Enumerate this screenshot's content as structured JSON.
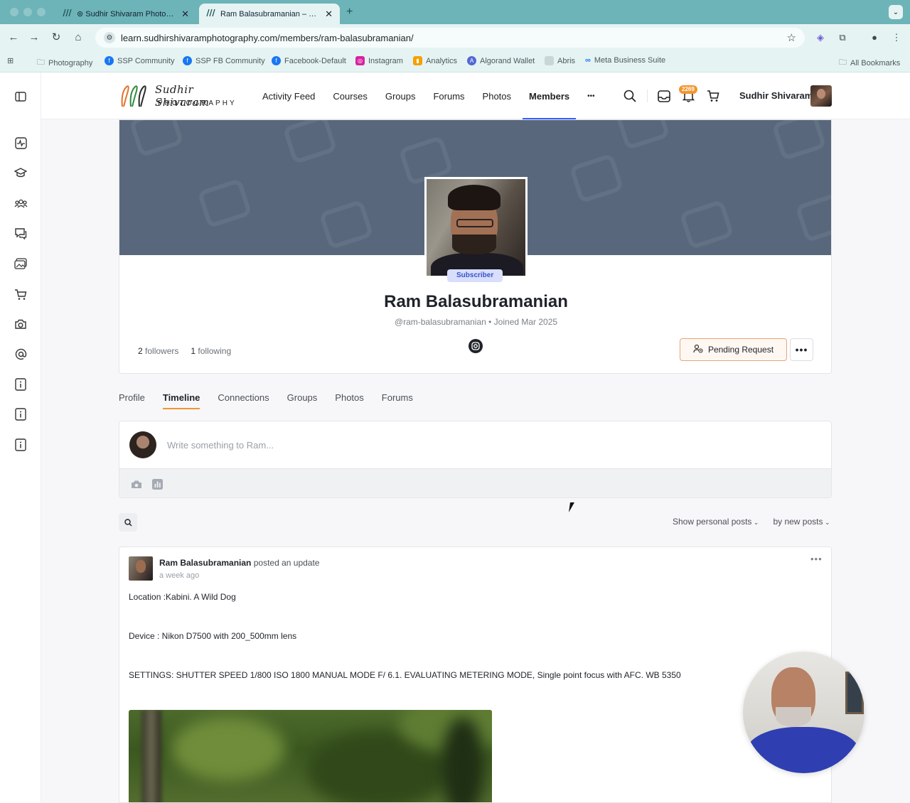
{
  "browser": {
    "tabs": [
      {
        "title": "⊚ Sudhir Shivaram Photography",
        "active": false
      },
      {
        "title": "Ram Balasubramanian – ⊚ Sudhir Shivaram Photography",
        "active": true
      }
    ],
    "url": "learn.sudhirshivaramphotography.com/members/ram-balasubramanian/",
    "bookmarks": [
      {
        "label": "Photography",
        "icon": "folder-icon"
      },
      {
        "label": "SSP Community",
        "icon": "facebook-icon"
      },
      {
        "label": "SSP FB Community",
        "icon": "facebook-icon"
      },
      {
        "label": "Facebook-Default",
        "icon": "facebook-icon"
      },
      {
        "label": "Instagram",
        "icon": "instagram-icon"
      },
      {
        "label": "Analytics",
        "icon": "analytics-icon"
      },
      {
        "label": "Algorand Wallet",
        "icon": "algorand-icon"
      },
      {
        "label": "Abris",
        "icon": "abris-icon"
      },
      {
        "label": "Meta Business Suite",
        "icon": "meta-icon"
      }
    ],
    "all_bookmarks": "All Bookmarks"
  },
  "site": {
    "logo": {
      "script": "Sudhir Shivaram",
      "sub": "PHOTOGRAPHY"
    },
    "nav": [
      "Activity Feed",
      "Courses",
      "Groups",
      "Forums",
      "Photos",
      "Members",
      "•••"
    ],
    "nav_active": "Members",
    "notification_count": "2269",
    "user_name": "Sudhir Shivaram"
  },
  "profile": {
    "role": "Subscriber",
    "name": "Ram Balasubramanian",
    "meta": "@ram-balasubramanian • Joined Mar 2025",
    "followers_count": "2",
    "followers_label": "followers",
    "following_count": "1",
    "following_label": "following",
    "pending_label": "Pending Request"
  },
  "profile_tabs": [
    "Profile",
    "Timeline",
    "Connections",
    "Groups",
    "Photos",
    "Forums"
  ],
  "active_profile_tab": "Timeline",
  "composer": {
    "placeholder": "Write something to Ram..."
  },
  "filters": {
    "show": "Show personal posts",
    "order": "by new posts"
  },
  "post": {
    "author": "Ram Balasubramanian",
    "action": "posted an update",
    "time": "a week ago",
    "lines": [
      "Location :Kabini. A Wild Dog",
      "Device : Nikon D7500 with 200_500mm lens",
      "SETTINGS: SHUTTER SPEED 1/800 ISO 1800 MANUAL MODE F/ 6.1. EVALUATING METERING MODE, Single point focus with AFC. WB 5350"
    ]
  },
  "colors": {
    "accent": "#385dff",
    "orange": "#f3952f",
    "cover": "#58677c",
    "browser": "#6db4b8"
  }
}
